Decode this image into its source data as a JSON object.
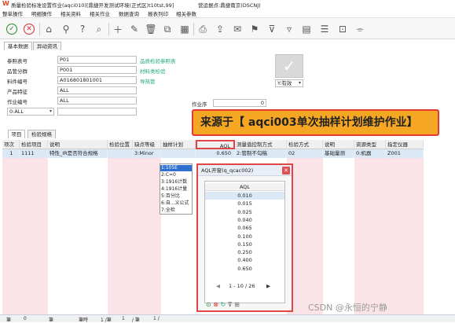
{
  "window": {
    "title_parts": [
      "质量检验标准设置作业(aqci010)",
      "[鼎捷开发测试环境(正式区)t10tst,99]",
      "营运据点:鼎捷南京(DSCNJ)"
    ]
  },
  "menubar": [
    "整单操作",
    "明细操作",
    "相关资料",
    "相关作业",
    "数据查询",
    "报表列印",
    "相关参数"
  ],
  "toolbar": {
    "icons": [
      "check-icon",
      "cancel-icon",
      "home-icon",
      "pin-icon",
      "help-icon",
      "search-icon",
      "add-icon",
      "edit-icon",
      "delete-icon",
      "copy-icon",
      "layout-icon",
      "print-icon",
      "export-icon",
      "note-icon",
      "flag-icon",
      "filter-icon",
      "funnel-icon",
      "chart-icon",
      "comment-icon",
      "link-icon"
    ]
  },
  "top_tabs": [
    "基本数据",
    "异动资讯"
  ],
  "form": {
    "fields": [
      {
        "label": "参照表号",
        "value": "P01",
        "link": "品质检验参照表"
      },
      {
        "label": "品管分群",
        "value": "P001",
        "link": "材料类检验"
      },
      {
        "label": "料件编号",
        "value": "A016801801001",
        "link": "导热管"
      },
      {
        "label": "产品特征",
        "value": "ALL",
        "link": ""
      },
      {
        "label": "作业编号",
        "value": "ALL",
        "link": ""
      },
      {
        "label": "",
        "value": "0:ALL",
        "link": ""
      }
    ],
    "status_select": "Y:有效",
    "extra_label": "作业序",
    "extra_value": "0"
  },
  "banner": "来源于【 aqci003单次抽样计划维护作业】",
  "detail_tabs": [
    "项目",
    "检验规格"
  ],
  "grid": {
    "headers": [
      "项次",
      "检验项目",
      "说明",
      "检验位置",
      "缺点等级",
      "抽样计划",
      "AQL",
      "测量值控制方式",
      "",
      "检验方式",
      "说明",
      "资源类型",
      "指定仪器"
    ],
    "row": [
      "1",
      "1111",
      "特性_IR是否符合规格",
      "",
      "3:Minor",
      "",
      "0.650",
      "2:管制不勾稿",
      "",
      "02",
      "基础量测",
      "0:机器",
      "Z001"
    ]
  },
  "sampling_options": [
    "1:105E",
    "2:C=0",
    "3:1916计数",
    "4:1916计量",
    "5:百分比",
    "6:自...义公式",
    "7:全检"
  ],
  "aql_dialog": {
    "title": "AQL开窗(q_qcac002)",
    "column": "AQL",
    "values": [
      "0.010",
      "0.015",
      "0.025",
      "0.040",
      "0.065",
      "0.100",
      "0.150",
      "0.250",
      "0.400",
      "0.650"
    ],
    "pager": "1 - 10 / 26"
  },
  "statusbar": [
    "筆",
    "0",
    "筆",
    "筆時",
    "1 /筆",
    "1",
    "/ 筆",
    "1 /"
  ],
  "watermark": "CSDN @永恒的宁静",
  "colors": {
    "accent_pink": "#fbe4e8",
    "banner_orange": "#f5a623",
    "highlight_red": "#e04646",
    "link_green": "#2a7"
  }
}
